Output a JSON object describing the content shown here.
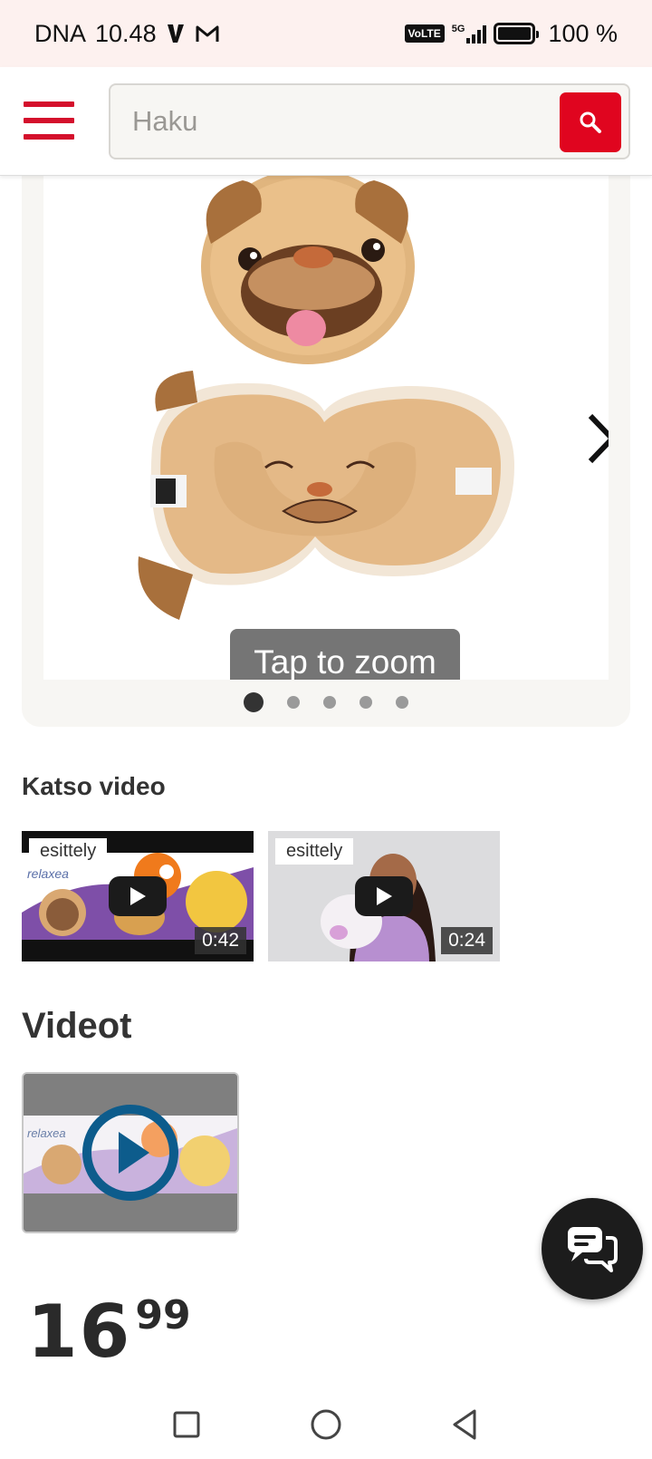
{
  "status_bar": {
    "carrier": "DNA",
    "time": "10.48",
    "network": "5G",
    "volte": "VoLTE",
    "battery": "100 %"
  },
  "header": {
    "search_placeholder": "Haku",
    "brand_color": "#e0051f"
  },
  "gallery": {
    "zoom_hint": "Tap to zoom",
    "slide_count": 5,
    "active_slide": 1
  },
  "katso_video": {
    "title": "Katso video",
    "videos": [
      {
        "tag": "esittely",
        "duration": "0:42"
      },
      {
        "tag": "esittely",
        "duration": "0:24"
      }
    ]
  },
  "videot": {
    "title": "Videot"
  },
  "price": {
    "integer": "16",
    "decimals": "99"
  }
}
